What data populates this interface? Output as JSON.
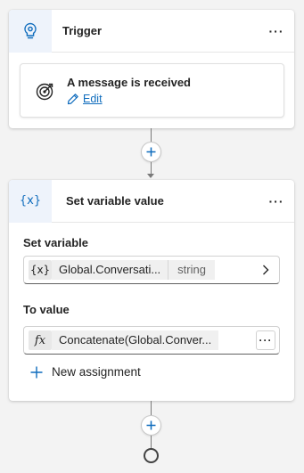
{
  "trigger": {
    "title": "Trigger",
    "more": "···",
    "event": "A message is received",
    "edit_label": "Edit"
  },
  "set_variable_node": {
    "icon_text": "{x}",
    "title": "Set variable value",
    "more": "···",
    "set_variable_label": "Set variable",
    "variable": {
      "icon_text": "{x}",
      "name": "Global.Conversati...",
      "type": "string"
    },
    "to_value_label": "To value",
    "value": {
      "icon_text": "fx",
      "expression": "Concatenate(Global.Conver...",
      "more": "···"
    },
    "new_assignment_label": "New assignment"
  },
  "colors": {
    "accent": "#0f6cbd",
    "canvas": "#f3f3f3",
    "icon_box": "#eef3fb"
  }
}
